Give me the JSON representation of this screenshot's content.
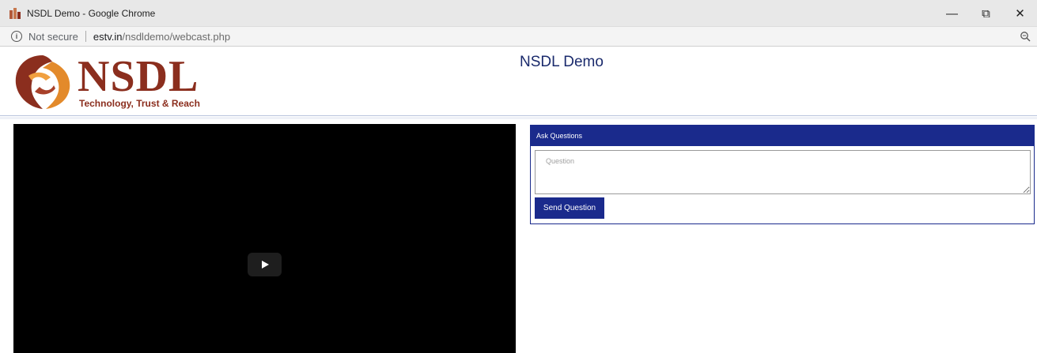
{
  "browser": {
    "window_title": "NSDL Demo - Google Chrome",
    "security_label": "Not secure",
    "url_host": "estv.in",
    "url_path": "/nsdldemo/webcast.php",
    "controls": {
      "minimize": "—",
      "restore": "⧉",
      "close": "✕"
    }
  },
  "header": {
    "logo_word": "NSDL",
    "logo_tagline": "Technology, Trust & Reach",
    "site_title": "NSDL Demo"
  },
  "questions": {
    "heading": "Ask Questions",
    "placeholder": "Question",
    "send_label": "Send Question"
  },
  "colors": {
    "brand_navy": "#1a2a8c",
    "logo_maroon": "#8b2e1e",
    "logo_orange": "#e38a2b"
  }
}
